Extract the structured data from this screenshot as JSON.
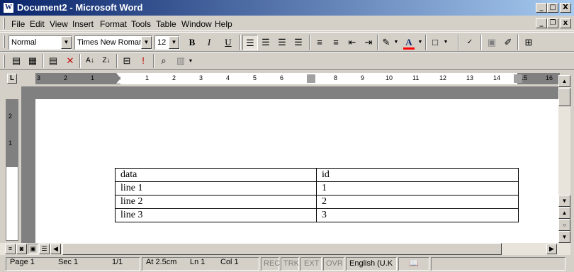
{
  "window": {
    "title": "Document2 - Microsoft Word",
    "app_icon": "W",
    "controls": {
      "minimize": "_",
      "maximize": "□",
      "close": "X"
    }
  },
  "menu": [
    "File",
    "Edit",
    "View",
    "Insert",
    "Format",
    "Tools",
    "Table",
    "Window",
    "Help"
  ],
  "formatting_toolbar": {
    "style": "Normal",
    "font": "Times New Roman",
    "size": "12",
    "bold": "B",
    "italic": "I",
    "underline": "U"
  },
  "ruler": {
    "numbers": [
      "3",
      "2",
      "1",
      "1",
      "2",
      "3",
      "4",
      "5",
      "6",
      "7",
      "8",
      "9",
      "10",
      "11",
      "12",
      "13",
      "14",
      "15",
      "16"
    ],
    "tab_selector": "L"
  },
  "table": {
    "rows": [
      [
        "data",
        "id"
      ],
      [
        "line 1",
        "1"
      ],
      [
        "line 2",
        "2"
      ],
      [
        "line 3",
        "3"
      ]
    ]
  },
  "status": {
    "page": "Page 1",
    "sec": "Sec 1",
    "pages": "1/1",
    "at": "At 2.5cm",
    "ln": "Ln 1",
    "col": "Col 1",
    "rec": "REC",
    "trk": "TRK",
    "ext": "EXT",
    "ovr": "OVR",
    "language": "English (U.K"
  },
  "colors": {
    "title_start": "#0a246a",
    "title_end": "#a6caf0",
    "font_color": "#ff0000",
    "highlight": "#ffff00"
  }
}
